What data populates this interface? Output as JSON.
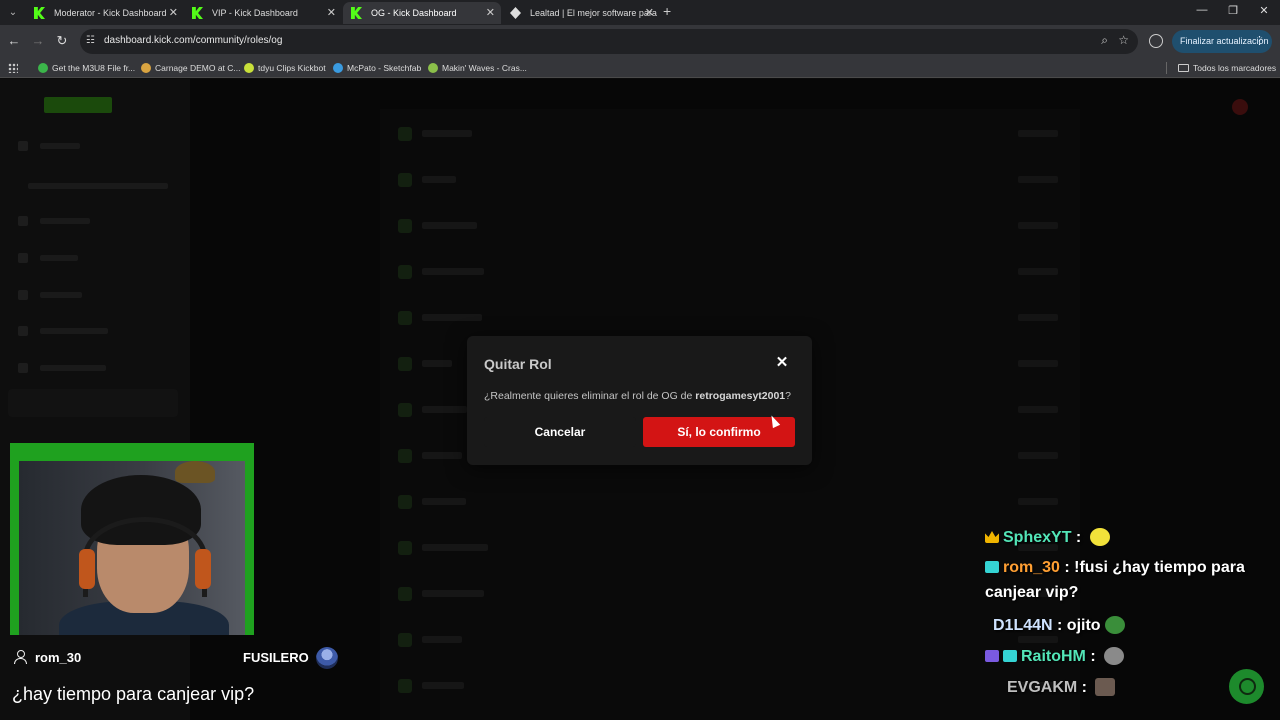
{
  "browser": {
    "tabs": [
      {
        "title": "Moderator - Kick Dashboard",
        "favicon": "kick-icon",
        "active": false
      },
      {
        "title": "VIP - Kick Dashboard",
        "favicon": "kick-icon",
        "active": false
      },
      {
        "title": "OG - Kick Dashboard",
        "favicon": "kick-icon",
        "active": true
      },
      {
        "title": "Lealtad | El mejor software para",
        "favicon": "loyalty-icon",
        "active": false
      }
    ],
    "url": "dashboard.kick.com/community/roles/og",
    "update_button": "Finalizar actualización",
    "bookmarks": [
      {
        "label": "Get the M3U8 File fr...",
        "color": "#3bb54a"
      },
      {
        "label": "Carnage DEMO at C...",
        "color": "#d9a441"
      },
      {
        "label": "tdyu Clips Kickbot",
        "color": "#c8e03a"
      },
      {
        "label": "McPato - Sketchfab",
        "color": "#3a9be0"
      },
      {
        "label": "Makin' Waves - Cras...",
        "color": "#8bbf4a"
      }
    ],
    "all_bookmarks": "Todos los marcadores"
  },
  "modal": {
    "title": "Quitar Rol",
    "message_prefix": "¿Realmente quieres eliminar el rol de OG de ",
    "username": "retrogamesyt2001",
    "message_suffix": "?",
    "cancel_label": "Cancelar",
    "confirm_label": "Sí, lo confirmo",
    "confirm_color": "#d31414"
  },
  "highlight": {
    "username": "rom_30",
    "badge": "FUSILERO",
    "message": "¿hay tiempo para canjear vip?"
  },
  "chat": [
    {
      "user": "SphexYT",
      "text": "",
      "badges": [
        "crown"
      ],
      "emote": true
    },
    {
      "user": "rom_30",
      "text": "!fusi ¿hay tiempo para",
      "text2": "canjear vip?",
      "badges": [
        "og"
      ],
      "emote": false
    },
    {
      "user": "D1L44N",
      "text": "ojito",
      "badges": [],
      "emote": true
    },
    {
      "user": "RaitoHM",
      "text": "",
      "badges": [
        "mod",
        "og"
      ],
      "emote": true
    },
    {
      "user": "EVGAKM",
      "text": "",
      "badges": [],
      "emote": true
    }
  ],
  "colors": {
    "kick_green": "#53fc18",
    "confirm_red": "#d31414"
  }
}
